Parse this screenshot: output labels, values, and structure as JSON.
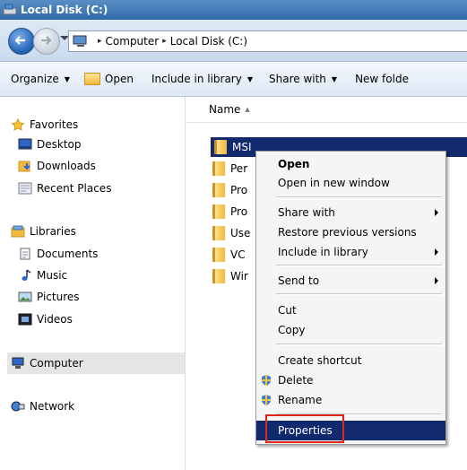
{
  "window": {
    "title": "Local Disk (C:)"
  },
  "address": {
    "crumbs": [
      "Computer",
      "Local Disk (C:)"
    ]
  },
  "toolbar": {
    "organize": "Organize",
    "open": "Open",
    "include_in_library": "Include in library",
    "share_with": "Share with",
    "new_folder": "New folde"
  },
  "sidebar": {
    "favorites": "Favorites",
    "desktop": "Desktop",
    "downloads": "Downloads",
    "recent_places": "Recent Places",
    "libraries": "Libraries",
    "documents": "Documents",
    "music": "Music",
    "pictures": "Pictures",
    "videos": "Videos",
    "computer": "Computer",
    "network": "Network"
  },
  "list": {
    "column_name": "Name",
    "items": [
      "MSI",
      "Per",
      "Pro",
      "Pro",
      "Use",
      "VC",
      "Wir"
    ]
  },
  "context_menu": {
    "open": "Open",
    "open_new_window": "Open in new window",
    "share_with": "Share with",
    "restore_previous": "Restore previous versions",
    "include_in_library": "Include in library",
    "send_to": "Send to",
    "cut": "Cut",
    "copy": "Copy",
    "create_shortcut": "Create shortcut",
    "delete": "Delete",
    "rename": "Rename",
    "properties": "Properties"
  },
  "colors": {
    "selection": "#102a6d",
    "highlight_box": "#e0251b"
  }
}
